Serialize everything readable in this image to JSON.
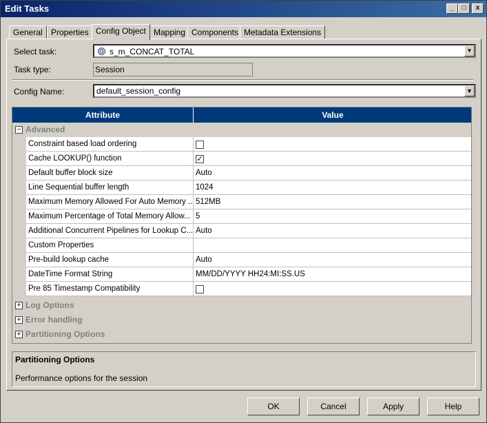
{
  "window": {
    "title": "Edit Tasks",
    "controls": {
      "minimize": "_",
      "maximize": "□",
      "close": "x"
    }
  },
  "tabs": [
    {
      "label": "General",
      "active": false
    },
    {
      "label": "Properties",
      "active": false
    },
    {
      "label": "Config Object",
      "active": true
    },
    {
      "label": "Mapping",
      "active": false
    },
    {
      "label": "Components",
      "active": false
    },
    {
      "label": "Metadata Extensions",
      "active": false
    }
  ],
  "form": {
    "select_task_label": "Select task:",
    "select_task_value": "s_m_CONCAT_TOTAL",
    "task_type_label": "Task type:",
    "task_type_value": "Session",
    "config_name_label": "Config Name:",
    "config_name_value": "default_session_config"
  },
  "grid": {
    "headers": {
      "attribute": "Attribute",
      "value": "Value"
    },
    "advanced_section": "Advanced",
    "rows": [
      {
        "attribute": "Constraint based load ordering",
        "value": "",
        "checkbox": true,
        "checked": false
      },
      {
        "attribute": "Cache LOOKUP() function",
        "value": "",
        "checkbox": true,
        "checked": true
      },
      {
        "attribute": "Default buffer block size",
        "value": "Auto"
      },
      {
        "attribute": "Line Sequential buffer length",
        "value": "1024"
      },
      {
        "attribute": "Maximum Memory Allowed For Auto Memory ...",
        "value": "512MB"
      },
      {
        "attribute": "Maximum Percentage of Total Memory Allow...",
        "value": "5"
      },
      {
        "attribute": "Additional Concurrent Pipelines for Lookup C...",
        "value": "Auto"
      },
      {
        "attribute": "Custom Properties",
        "value": ""
      },
      {
        "attribute": "Pre-build lookup cache",
        "value": "Auto"
      },
      {
        "attribute": "DateTime Format String",
        "value": "MM/DD/YYYY HH24:MI:SS.US"
      },
      {
        "attribute": "Pre 85 Timestamp Compatibility",
        "value": "",
        "checkbox": true,
        "checked": false
      }
    ],
    "collapsed_sections": [
      "Log Options",
      "Error handling",
      "Partitioning Options"
    ]
  },
  "description": {
    "title": "Partitioning Options",
    "text": "Performance options for the session"
  },
  "buttons": {
    "ok": "OK",
    "cancel": "Cancel",
    "apply": "Apply",
    "help": "Help"
  },
  "colors": {
    "header_bg": "#003a7a",
    "dialog_bg": "#d4d0c8",
    "title_bar": "#0a246a"
  }
}
